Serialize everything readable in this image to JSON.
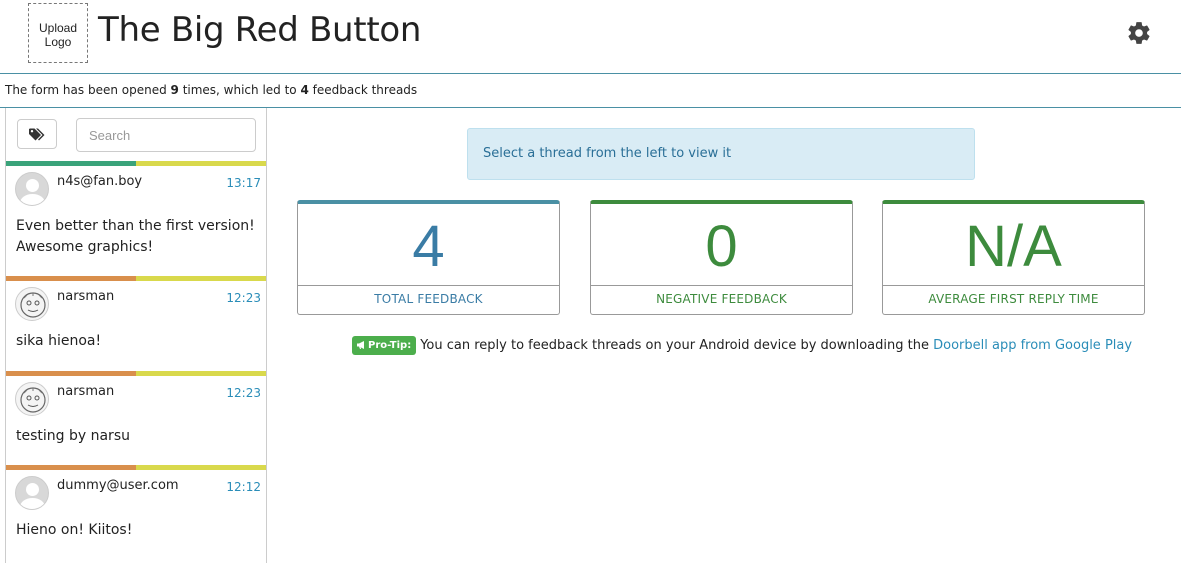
{
  "header": {
    "logo_label": "Upload Logo",
    "title": "The Big Red Button",
    "settings_icon": "gear-icon"
  },
  "stats": {
    "prefix": "The form has been opened ",
    "opened_count": "9",
    "middle": " times, which led to ",
    "thread_count": "4",
    "suffix": " feedback threads"
  },
  "sidebar": {
    "tag_icon": "tags-icon",
    "search_placeholder": "Search",
    "threads": [
      {
        "name": "n4s@fan.boy",
        "time": "13:17",
        "message": "Even better than the first version! Awesome graphics!",
        "avatar": "user-avatar",
        "bar_colors": [
          "#3aa37a",
          "#d9d94c"
        ]
      },
      {
        "name": "narsman",
        "time": "12:23",
        "message": "sika hienoa!",
        "avatar": "face-avatar",
        "bar_colors": [
          "#d98f4c",
          "#d9d94c"
        ]
      },
      {
        "name": "narsman",
        "time": "12:23",
        "message": "testing by narsu",
        "avatar": "face-avatar",
        "bar_colors": [
          "#d98f4c",
          "#d9d94c"
        ]
      },
      {
        "name": "dummy@user.com",
        "time": "12:12",
        "message": "Hieno on! Kiitos!",
        "avatar": "user-avatar",
        "bar_colors": [
          "#d98f4c",
          "#d9d94c"
        ]
      }
    ]
  },
  "main": {
    "notice": "Select a thread from the left to view it",
    "cards": [
      {
        "value": "4",
        "label": "TOTAL FEEDBACK",
        "color": "#3a7ca5",
        "border": "#4a90a4"
      },
      {
        "value": "0",
        "label": "NEGATIVE FEEDBACK",
        "color": "#3d8b3d",
        "border": "#3d8b3d"
      },
      {
        "value": "N/A",
        "label": "AVERAGE FIRST REPLY TIME",
        "color": "#3d8b3d",
        "border": "#3d8b3d"
      }
    ],
    "protip": {
      "badge": "Pro-Tip:",
      "text": "You can reply to feedback threads on your Android device by downloading the ",
      "link": "Doorbell app from Google Play"
    }
  }
}
